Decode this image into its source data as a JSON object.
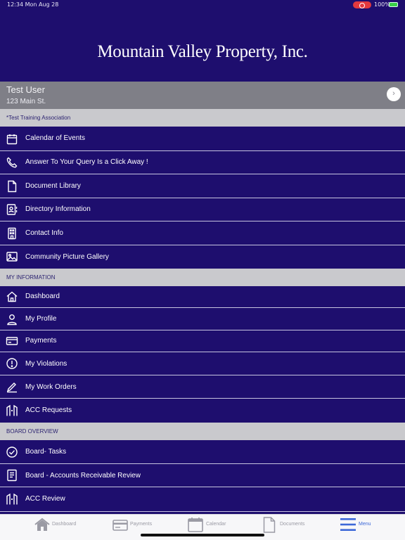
{
  "status_bar": {
    "time": "12:34  Mon Aug 28",
    "battery_pct": "100%",
    "battery_level": 1.0,
    "record_color": "#e3393e"
  },
  "brand": {
    "title": "Mountain Valley Property, Inc."
  },
  "user": {
    "name": "Test User",
    "address": "123 Main St."
  },
  "association": {
    "label": "*Test Training Association"
  },
  "association_items": [
    {
      "label": "Calendar of Events",
      "icon": "calendar-icon"
    },
    {
      "label": "Answer To Your Query Is a Click Away !",
      "icon": "phone-icon"
    },
    {
      "label": "Document Library",
      "icon": "document-icon"
    },
    {
      "label": "Directory Information",
      "icon": "contact-card-icon"
    },
    {
      "label": "Contact Info",
      "icon": "building-icon"
    },
    {
      "label": "Community Picture Gallery",
      "icon": "picture-icon"
    }
  ],
  "my_info": {
    "label": "MY INFORMATION"
  },
  "my_info_items": [
    {
      "label": "Dashboard",
      "icon": "home-icon"
    },
    {
      "label": "My Profile",
      "icon": "person-icon"
    },
    {
      "label": "Payments",
      "icon": "credit-card-icon"
    },
    {
      "label": "My Violations",
      "icon": "alert-circle-icon"
    },
    {
      "label": "My Work Orders",
      "icon": "pencil-icon"
    },
    {
      "label": "ACC Requests",
      "icon": "acc-icon"
    }
  ],
  "board": {
    "label": "BOARD OVERVIEW"
  },
  "board_items": [
    {
      "label": "Board- Tasks",
      "icon": "check-circle-icon"
    },
    {
      "label": "Board - Accounts Receivable Review",
      "icon": "ledger-icon"
    },
    {
      "label": "ACC Review",
      "icon": "acc-icon"
    }
  ],
  "tabs": [
    {
      "label": "Dashboard",
      "icon": "home-icon"
    },
    {
      "label": "Payments",
      "icon": "credit-card-icon"
    },
    {
      "label": "Calendar",
      "icon": "calendar-icon"
    },
    {
      "label": "Documents",
      "icon": "document-icon"
    },
    {
      "label": "Menu",
      "icon": "menu-icon",
      "active": true
    }
  ],
  "colors": {
    "background": "#1e0e6e",
    "section": "#c9c9cd",
    "user_panel": "#7f7f87",
    "tab_active": "#3d68d8"
  }
}
